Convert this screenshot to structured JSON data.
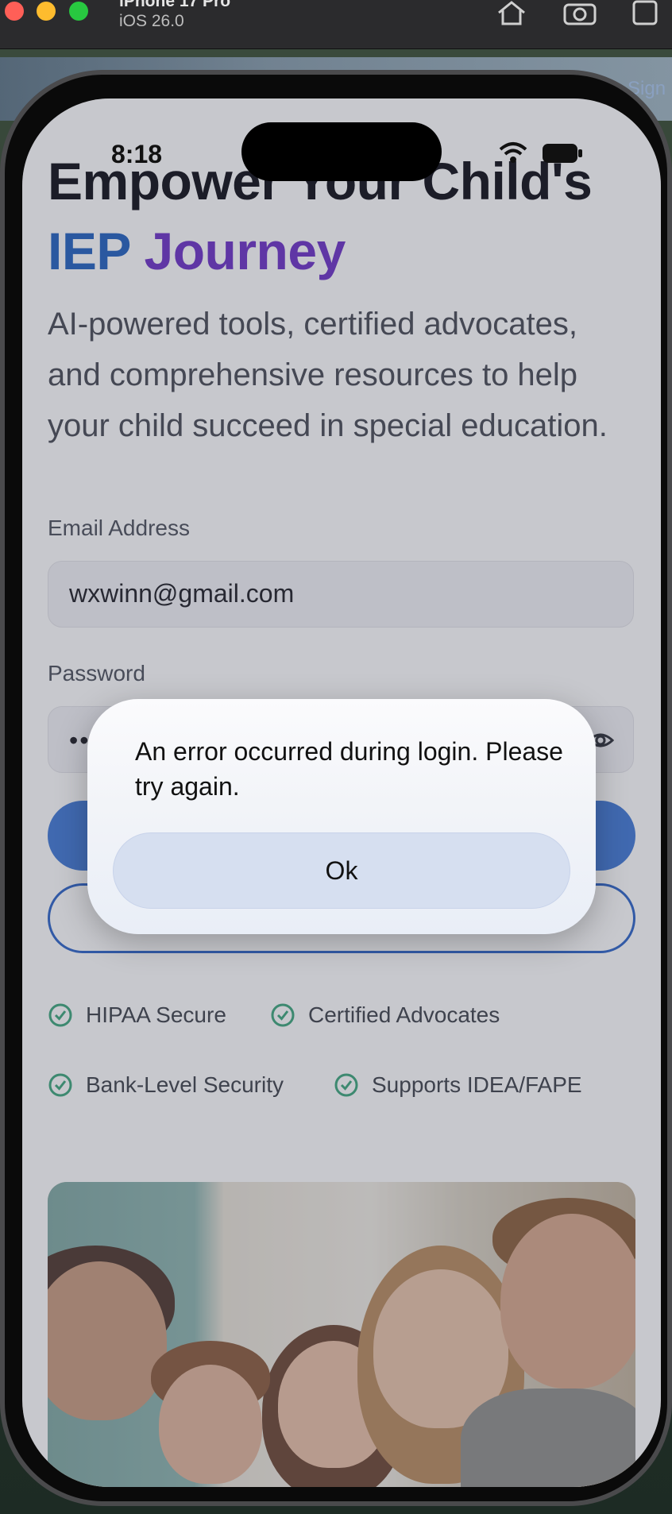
{
  "toolbar": {
    "device_name": "iPhone 17 Pro",
    "os_version": "iOS 26.0",
    "background_link": "Sign"
  },
  "status_bar": {
    "time": "8:18"
  },
  "hero": {
    "title_line1": "Empower Your Child's",
    "title_word1": "IEP",
    "title_word2": "Journey",
    "subtitle": "AI-powered tools, certified advocates, and comprehensive resources to help your child succeed in special education."
  },
  "form": {
    "email_label": "Email Address",
    "email_value": "wxwinn@gmail.com",
    "password_label": "Password",
    "password_mask": "••"
  },
  "trust_badges": [
    "HIPAA Secure",
    "Certified Advocates",
    "Bank-Level Security",
    "Supports IDEA/FAPE"
  ],
  "alert": {
    "message": "An error occurred during login. Please try again.",
    "button_label": "Ok"
  },
  "colors": {
    "iep_blue": "#1f5fbf",
    "journey_purple": "#6a2fc6",
    "primary_button": "#3e78d6",
    "check_green": "#3aa57a"
  }
}
